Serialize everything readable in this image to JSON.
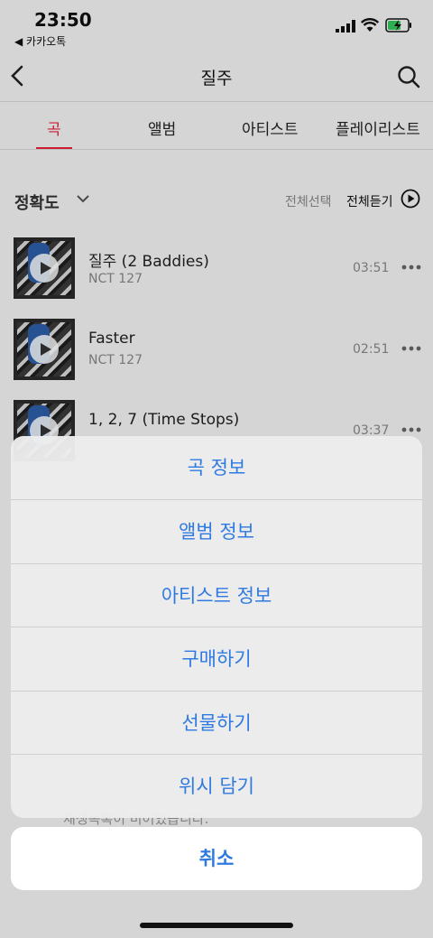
{
  "status": {
    "time": "23:50",
    "back_app": "◀ 카카오톡"
  },
  "header": {
    "title": "질주"
  },
  "tabs": [
    "곡",
    "앨범",
    "아티스트",
    "플레이리스트"
  ],
  "sort": {
    "label": "정확도",
    "select_all": "전체선택",
    "play_all": "전체듣기"
  },
  "songs": [
    {
      "title": "질주 (2 Baddies)",
      "artist": "NCT 127",
      "duration": "03:51"
    },
    {
      "title": "Faster",
      "artist": "NCT 127",
      "duration": "02:51"
    },
    {
      "title": "1, 2, 7 (Time Stops)",
      "artist": "",
      "duration": "03:37"
    }
  ],
  "player": {
    "message": "재생목록이 비어있습니다."
  },
  "action_sheet": {
    "items": [
      "곡 정보",
      "앨범 정보",
      "아티스트 정보",
      "구매하기",
      "선물하기",
      "위시 담기"
    ],
    "cancel": "취소"
  },
  "colors": {
    "accent": "#e8233b",
    "ios_blue": "#2f7ae0"
  }
}
